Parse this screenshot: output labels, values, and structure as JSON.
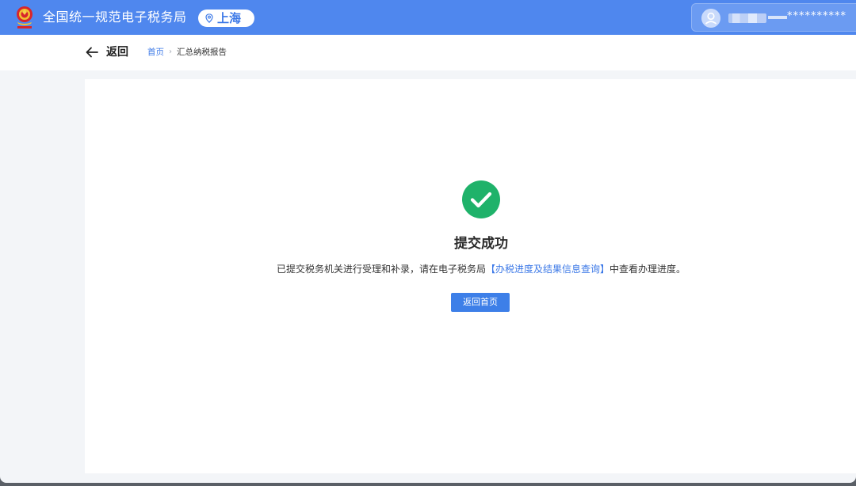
{
  "header": {
    "site_title": "全国统一规范电子税务局",
    "region": "上海",
    "user_masked": "**********",
    "brand_color": "#4f87ee"
  },
  "subnav": {
    "back_label": "返回",
    "breadcrumb_home": "首页",
    "breadcrumb_separator": "›",
    "breadcrumb_current": "汇总纳税报告"
  },
  "result": {
    "status_icon": "check-circle-icon",
    "status_color": "#1fb26a",
    "title": "提交成功",
    "message_before": "已提交税务机关进行受理和补录，请在电子税务局",
    "message_link": "【办税进度及结果信息查询】",
    "message_after": "中查看办理进度。",
    "home_button_label": "返回首页"
  },
  "icons": {
    "emblem": "national-emblem-icon",
    "region": "location-pin-icon",
    "user": "user-avatar-icon",
    "back": "arrow-left-icon"
  }
}
